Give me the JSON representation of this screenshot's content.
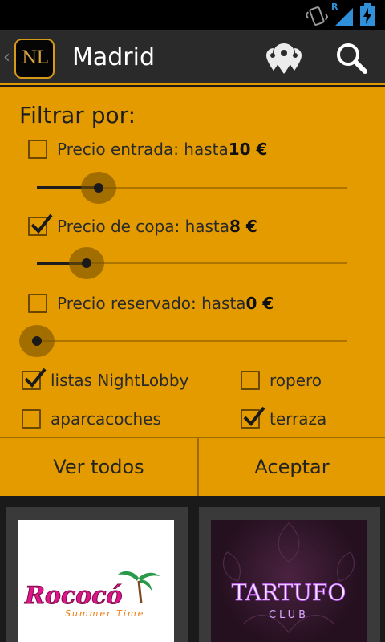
{
  "status_bar": {
    "icons": [
      "vibrate-icon",
      "roaming-icon",
      "signal-icon",
      "battery-charging-icon"
    ],
    "roaming_label": "R"
  },
  "action_bar": {
    "logo_text": "NL",
    "title": "Madrid",
    "icons": [
      "map-pins-icon",
      "search-icon"
    ]
  },
  "filter": {
    "heading": "Filtrar por:",
    "price_filters": [
      {
        "label": "Precio entrada: hasta",
        "value": "10 €",
        "checked": false,
        "slider_fraction": 0.2
      },
      {
        "label": "Precio de copa: hasta",
        "value": "8 €",
        "checked": true,
        "slider_fraction": 0.16
      },
      {
        "label": "Precio reservado: hasta",
        "value": "0 €",
        "checked": false,
        "slider_fraction": 0.0
      }
    ],
    "options": [
      {
        "label": "listas NightLobby",
        "checked": true
      },
      {
        "label": "ropero",
        "checked": false
      },
      {
        "label": "aparcacoches",
        "checked": false
      },
      {
        "label": "terraza",
        "checked": true
      }
    ]
  },
  "buttons": {
    "view_all": "Ver todos",
    "accept": "Aceptar"
  },
  "venues": [
    {
      "name": "Rococó",
      "subtitle": "Summer Time"
    },
    {
      "name": "TARTUFO",
      "subtitle": "CLUB"
    }
  ],
  "colors": {
    "accent": "#e39b00",
    "action_bar": "#2a2a2a",
    "status_bar": "#000000",
    "card_bg": "#3a3a3a"
  }
}
